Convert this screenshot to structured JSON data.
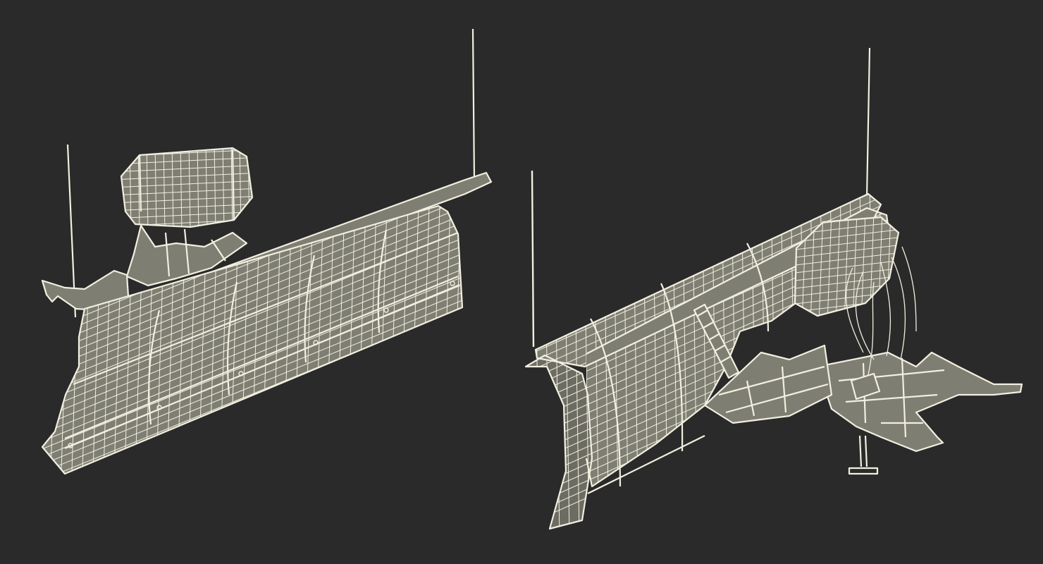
{
  "scene": {
    "background_color": "#2a2a2a",
    "wire_color": "#f1efe0",
    "surface_color": "#7f7e72",
    "surface_dark_color": "#6d6c62",
    "models": [
      {
        "name": "snow-plow-front-view"
      },
      {
        "name": "snow-plow-rear-view"
      }
    ]
  }
}
